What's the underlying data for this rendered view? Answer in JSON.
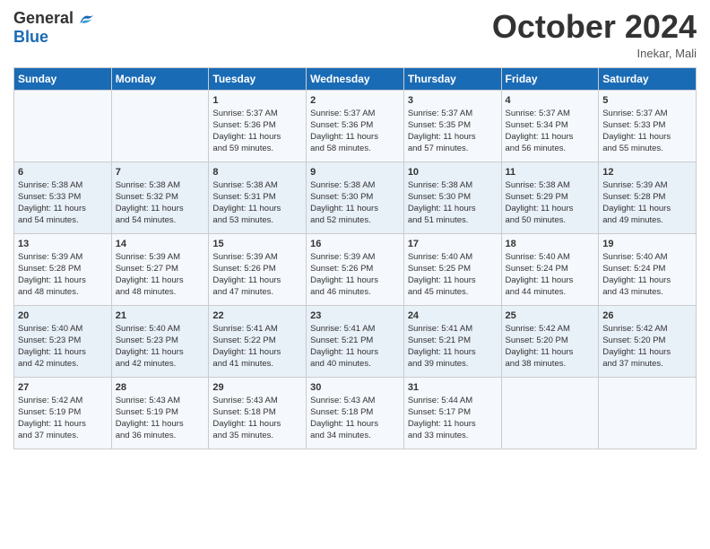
{
  "header": {
    "logo_general": "General",
    "logo_blue": "Blue",
    "month": "October 2024",
    "location": "Inekar, Mali"
  },
  "weekdays": [
    "Sunday",
    "Monday",
    "Tuesday",
    "Wednesday",
    "Thursday",
    "Friday",
    "Saturday"
  ],
  "weeks": [
    [
      {
        "day": "",
        "info": ""
      },
      {
        "day": "",
        "info": ""
      },
      {
        "day": "1",
        "info": "Sunrise: 5:37 AM\nSunset: 5:36 PM\nDaylight: 11 hours\nand 59 minutes."
      },
      {
        "day": "2",
        "info": "Sunrise: 5:37 AM\nSunset: 5:36 PM\nDaylight: 11 hours\nand 58 minutes."
      },
      {
        "day": "3",
        "info": "Sunrise: 5:37 AM\nSunset: 5:35 PM\nDaylight: 11 hours\nand 57 minutes."
      },
      {
        "day": "4",
        "info": "Sunrise: 5:37 AM\nSunset: 5:34 PM\nDaylight: 11 hours\nand 56 minutes."
      },
      {
        "day": "5",
        "info": "Sunrise: 5:37 AM\nSunset: 5:33 PM\nDaylight: 11 hours\nand 55 minutes."
      }
    ],
    [
      {
        "day": "6",
        "info": "Sunrise: 5:38 AM\nSunset: 5:33 PM\nDaylight: 11 hours\nand 54 minutes."
      },
      {
        "day": "7",
        "info": "Sunrise: 5:38 AM\nSunset: 5:32 PM\nDaylight: 11 hours\nand 54 minutes."
      },
      {
        "day": "8",
        "info": "Sunrise: 5:38 AM\nSunset: 5:31 PM\nDaylight: 11 hours\nand 53 minutes."
      },
      {
        "day": "9",
        "info": "Sunrise: 5:38 AM\nSunset: 5:30 PM\nDaylight: 11 hours\nand 52 minutes."
      },
      {
        "day": "10",
        "info": "Sunrise: 5:38 AM\nSunset: 5:30 PM\nDaylight: 11 hours\nand 51 minutes."
      },
      {
        "day": "11",
        "info": "Sunrise: 5:38 AM\nSunset: 5:29 PM\nDaylight: 11 hours\nand 50 minutes."
      },
      {
        "day": "12",
        "info": "Sunrise: 5:39 AM\nSunset: 5:28 PM\nDaylight: 11 hours\nand 49 minutes."
      }
    ],
    [
      {
        "day": "13",
        "info": "Sunrise: 5:39 AM\nSunset: 5:28 PM\nDaylight: 11 hours\nand 48 minutes."
      },
      {
        "day": "14",
        "info": "Sunrise: 5:39 AM\nSunset: 5:27 PM\nDaylight: 11 hours\nand 48 minutes."
      },
      {
        "day": "15",
        "info": "Sunrise: 5:39 AM\nSunset: 5:26 PM\nDaylight: 11 hours\nand 47 minutes."
      },
      {
        "day": "16",
        "info": "Sunrise: 5:39 AM\nSunset: 5:26 PM\nDaylight: 11 hours\nand 46 minutes."
      },
      {
        "day": "17",
        "info": "Sunrise: 5:40 AM\nSunset: 5:25 PM\nDaylight: 11 hours\nand 45 minutes."
      },
      {
        "day": "18",
        "info": "Sunrise: 5:40 AM\nSunset: 5:24 PM\nDaylight: 11 hours\nand 44 minutes."
      },
      {
        "day": "19",
        "info": "Sunrise: 5:40 AM\nSunset: 5:24 PM\nDaylight: 11 hours\nand 43 minutes."
      }
    ],
    [
      {
        "day": "20",
        "info": "Sunrise: 5:40 AM\nSunset: 5:23 PM\nDaylight: 11 hours\nand 42 minutes."
      },
      {
        "day": "21",
        "info": "Sunrise: 5:40 AM\nSunset: 5:23 PM\nDaylight: 11 hours\nand 42 minutes."
      },
      {
        "day": "22",
        "info": "Sunrise: 5:41 AM\nSunset: 5:22 PM\nDaylight: 11 hours\nand 41 minutes."
      },
      {
        "day": "23",
        "info": "Sunrise: 5:41 AM\nSunset: 5:21 PM\nDaylight: 11 hours\nand 40 minutes."
      },
      {
        "day": "24",
        "info": "Sunrise: 5:41 AM\nSunset: 5:21 PM\nDaylight: 11 hours\nand 39 minutes."
      },
      {
        "day": "25",
        "info": "Sunrise: 5:42 AM\nSunset: 5:20 PM\nDaylight: 11 hours\nand 38 minutes."
      },
      {
        "day": "26",
        "info": "Sunrise: 5:42 AM\nSunset: 5:20 PM\nDaylight: 11 hours\nand 37 minutes."
      }
    ],
    [
      {
        "day": "27",
        "info": "Sunrise: 5:42 AM\nSunset: 5:19 PM\nDaylight: 11 hours\nand 37 minutes."
      },
      {
        "day": "28",
        "info": "Sunrise: 5:43 AM\nSunset: 5:19 PM\nDaylight: 11 hours\nand 36 minutes."
      },
      {
        "day": "29",
        "info": "Sunrise: 5:43 AM\nSunset: 5:18 PM\nDaylight: 11 hours\nand 35 minutes."
      },
      {
        "day": "30",
        "info": "Sunrise: 5:43 AM\nSunset: 5:18 PM\nDaylight: 11 hours\nand 34 minutes."
      },
      {
        "day": "31",
        "info": "Sunrise: 5:44 AM\nSunset: 5:17 PM\nDaylight: 11 hours\nand 33 minutes."
      },
      {
        "day": "",
        "info": ""
      },
      {
        "day": "",
        "info": ""
      }
    ]
  ]
}
